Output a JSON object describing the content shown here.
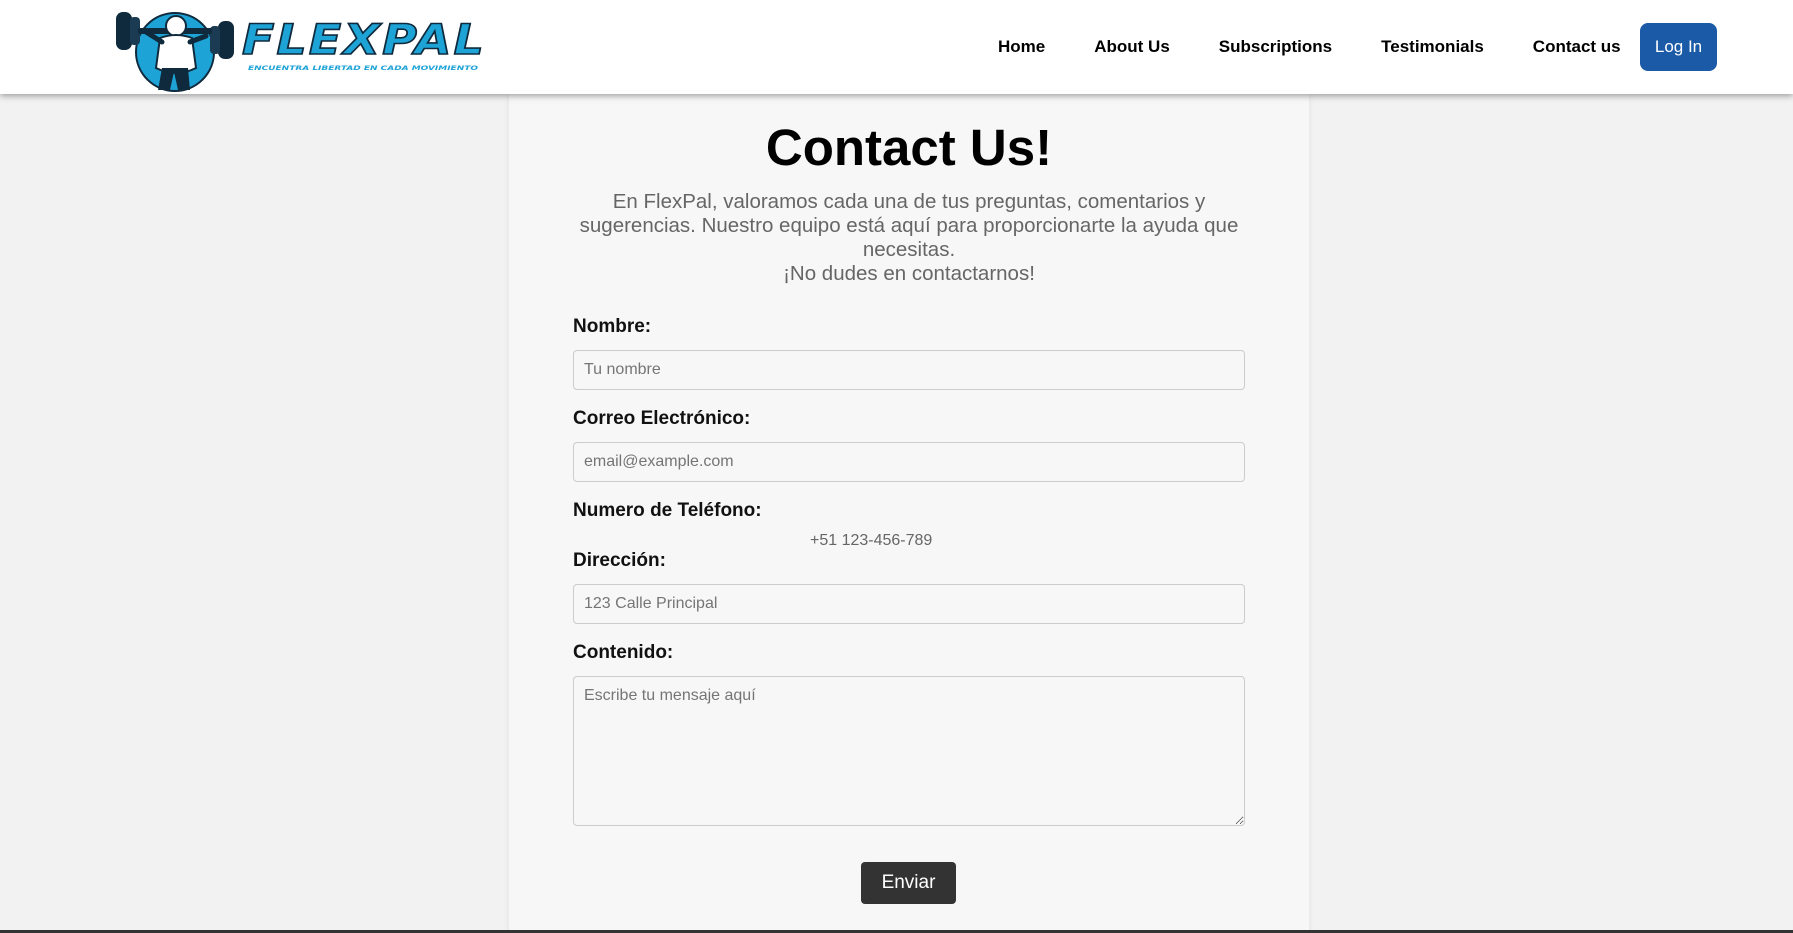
{
  "header": {
    "logo": {
      "brand": "FLEXPAL",
      "tagline": "ENCUENTRA LIBERTAD EN CADA MOVIMIENTO"
    },
    "nav": [
      {
        "label": "Home"
      },
      {
        "label": "About Us"
      },
      {
        "label": "Subscriptions"
      },
      {
        "label": "Testimonials"
      },
      {
        "label": "Contact us"
      }
    ],
    "login_label": "Log In"
  },
  "contact": {
    "title": "Contact Us!",
    "intro": "En FlexPal, valoramos cada una de tus preguntas, comentarios y sugerencias. Nuestro equipo está aquí para proporcionarte la ayuda que necesitas.",
    "cta": "¡No dudes en contactarnos!",
    "fields": {
      "name": {
        "label": "Nombre:",
        "placeholder": "Tu nombre"
      },
      "email": {
        "label": "Correo Electrónico:",
        "placeholder": "email@example.com"
      },
      "phone": {
        "label": "Numero de Teléfono:",
        "value": "+51 123-456-789"
      },
      "address": {
        "label": "Dirección:",
        "placeholder": "123 Calle Principal"
      },
      "content": {
        "label": "Contenido:",
        "placeholder": "Escribe tu mensaje aquí"
      }
    },
    "submit_label": "Enviar"
  },
  "colors": {
    "brand_accent": "#1ea3d6",
    "brand_dark": "#0f2a3d",
    "login_button": "#1a5aa6",
    "submit_button": "#333333",
    "page_background": "#f2f2f2",
    "panel_background": "#f7f7f7"
  },
  "icons": {
    "logo_mark": "weightlifter-icon"
  }
}
